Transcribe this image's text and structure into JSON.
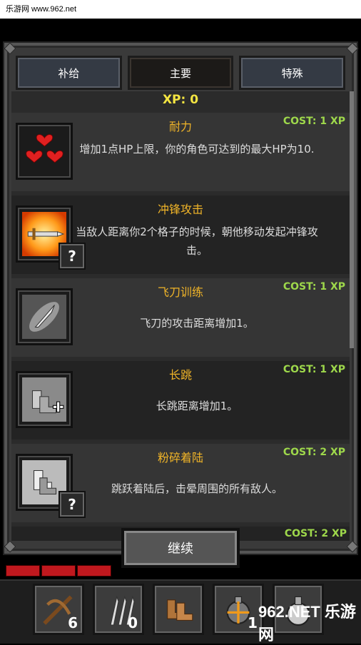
{
  "watermark_top": "乐游网 www.962.net",
  "tabs": [
    {
      "label": "补给"
    },
    {
      "label": "主要"
    },
    {
      "label": "特殊"
    }
  ],
  "xp_label": "XP: 0",
  "skills": [
    {
      "name": "耐力",
      "cost": "COST: 1 XP",
      "desc": "增加1点HP上限，你的角色可达到的最大HP为10."
    },
    {
      "name": "冲锋攻击",
      "cost": "",
      "desc": "当敌人距离你2个格子的时候，朝他移动发起冲锋攻击。"
    },
    {
      "name": "飞刀训练",
      "cost": "COST: 1 XP",
      "desc": "飞刀的攻击距离增加1。"
    },
    {
      "name": "长跳",
      "cost": "COST: 1 XP",
      "desc": "长跳距离增加1。"
    },
    {
      "name": "粉碎着陆",
      "cost": "COST: 2 XP",
      "desc": "跳跃着陆后，击晕周围的所有敌人。"
    }
  ],
  "last_cost": "COST: 2 XP",
  "continue_label": "继续",
  "question_mark": "?",
  "hotbar": [
    {
      "icon": "crossbow-icon",
      "count": "6"
    },
    {
      "icon": "throwing-knives-icon",
      "count": "0"
    },
    {
      "icon": "boots-icon",
      "count": ""
    },
    {
      "icon": "bomb-icon",
      "count": "1"
    },
    {
      "icon": "potion-icon",
      "count": ""
    }
  ],
  "watermark_bottom": "962.NET 乐游网"
}
